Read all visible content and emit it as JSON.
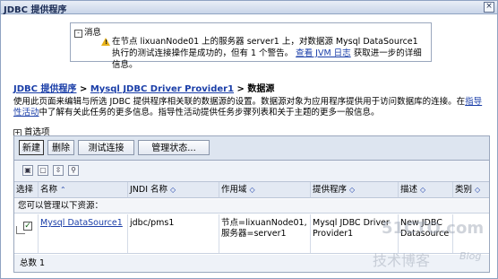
{
  "window": {
    "title": "JDBC 提供程序",
    "close_glyph": "×"
  },
  "message": {
    "header": "消息",
    "toggle": "-",
    "text_before": "在节点 lixuanNode01 上的服务器 server1 上，对数据源 Mysql DataSource1 执行的测试连接操作是成功的，但有 1 个警告。",
    "link": "查看 JVM 日志",
    "text_after": " 获取进一步的详细信息。"
  },
  "breadcrumb": {
    "item1": "JDBC 提供程序",
    "sep1": ">",
    "item2": "Mysql JDBC Driver Provider1",
    "sep2": ">",
    "current": "数据源"
  },
  "description": {
    "text": "使用此页面来编辑与所选 JDBC 提供程序相关联的数据源的设置。数据源对象为应用程序提供用于访问数据库的连接。在",
    "link": "指导性活动",
    "text_after": "中了解有关此任务的更多信息。指导性活动提供任务步骤列表和关于主题的更多一般信息。"
  },
  "preferences": {
    "toggle": "+",
    "label": "首选项"
  },
  "toolbar": {
    "new_label": "新建",
    "delete_label": "删除",
    "test_label": "测试连接",
    "manage_label": "管理状态..."
  },
  "table_icons": [
    "select-all-icon",
    "deselect-all-icon",
    "expand-filter-icon",
    "filter-icon"
  ],
  "table": {
    "headers": {
      "select": "选择",
      "name": "名称",
      "jndi": "JNDI 名称",
      "scope": "作用域",
      "provider": "提供程序",
      "desc": "描述",
      "category": "类别"
    },
    "sort_glyph": "◇",
    "resource_note": "您可以管理以下资源：",
    "row": {
      "checked": "✓",
      "name": "Mysql DataSource1",
      "jndi": "jdbc/pms1",
      "scope_line1": "节点=lixuanNode01,",
      "scope_line2": "服务器=server1",
      "provider_line1": "Mysql JDBC Driver",
      "provider_line2": "Provider1",
      "desc_line1": "New JDBC",
      "desc_line2": "Datasource",
      "category": ""
    },
    "total": "总数 1"
  },
  "watermark": {
    "site": "51CTO.com",
    "sub": "技术博客",
    "blog": "Blog"
  }
}
